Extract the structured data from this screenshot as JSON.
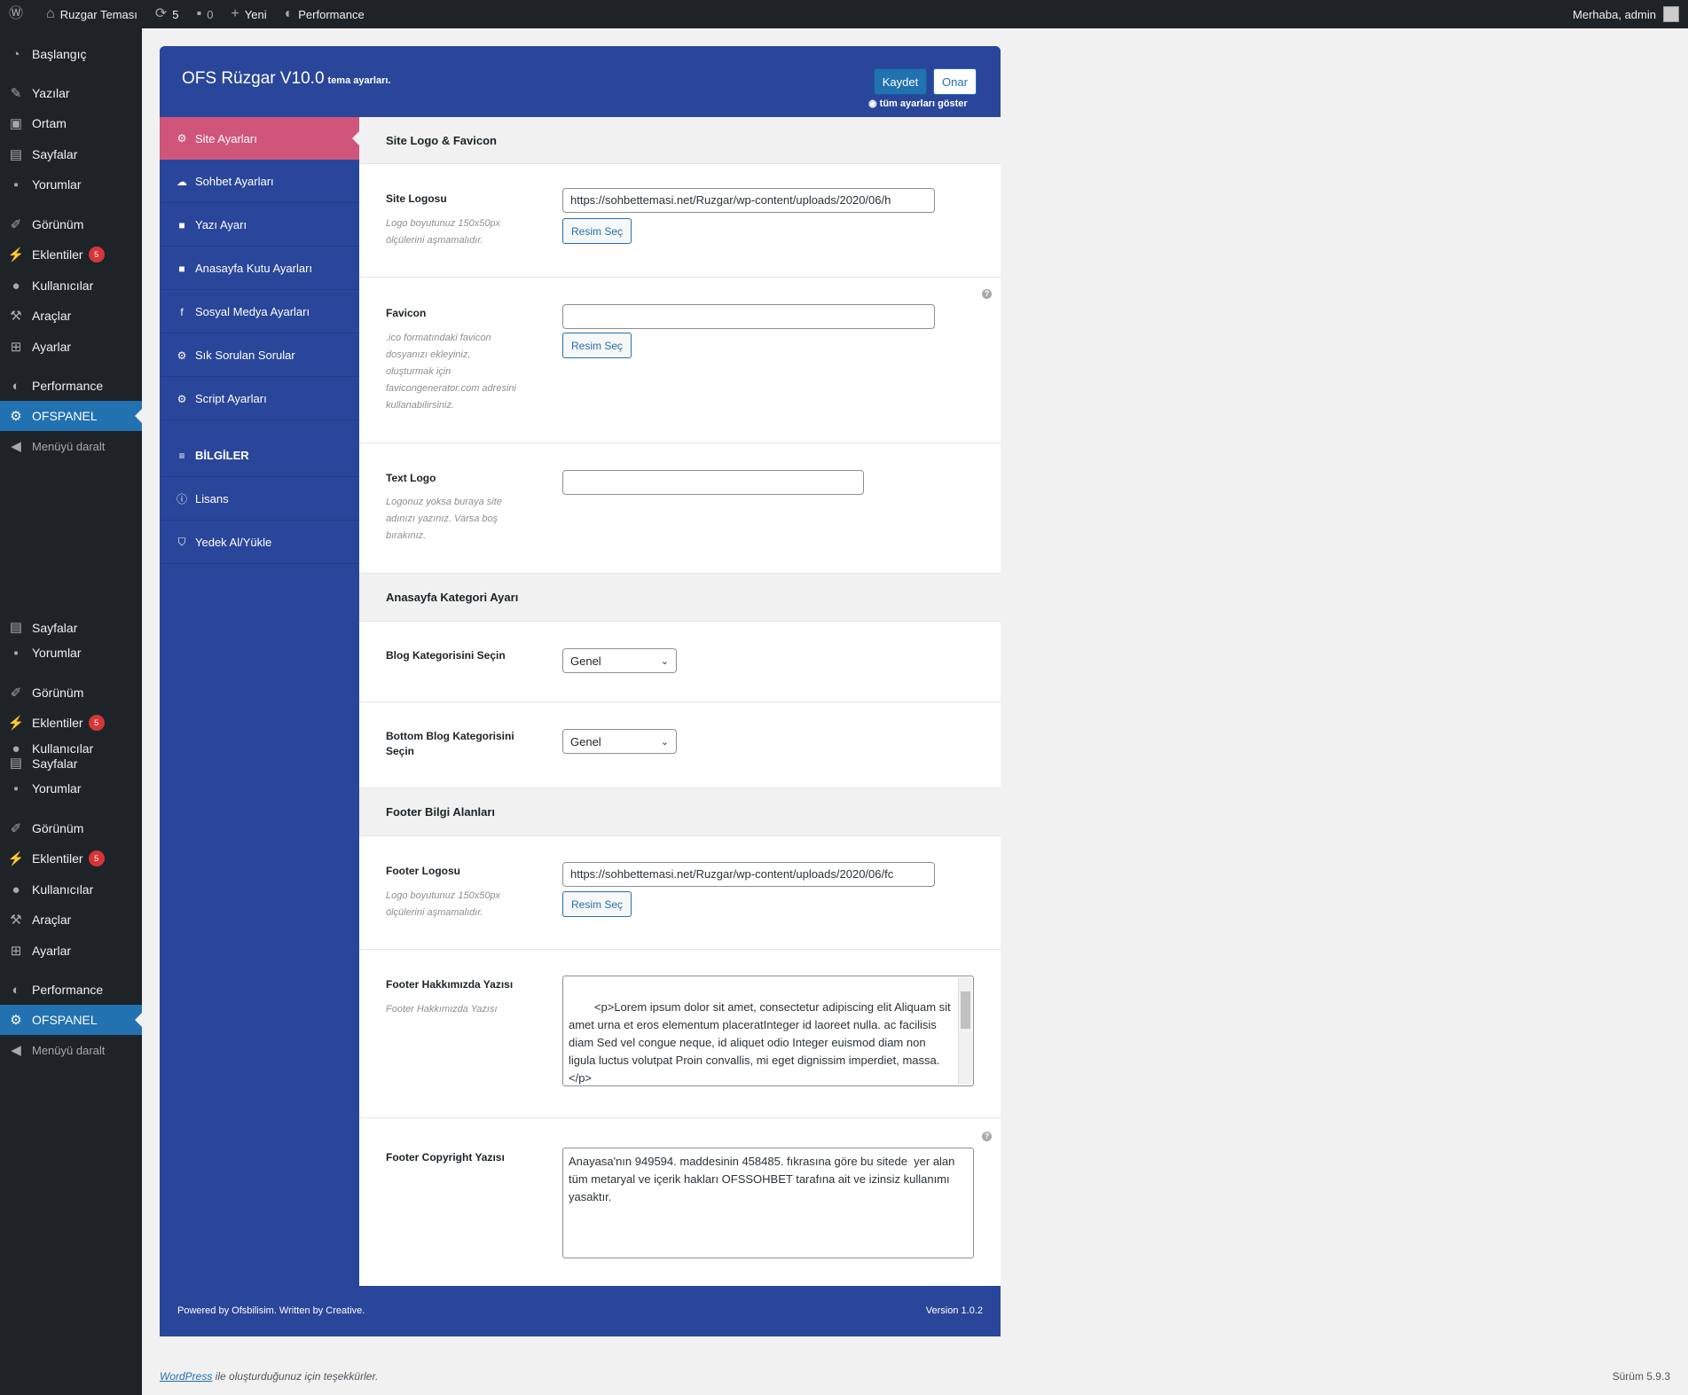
{
  "adminbar": {
    "site_name": "Ruzgar Teması",
    "updates_count": "5",
    "comments_count": "0",
    "new_label": "Yeni",
    "performance_label": "Performance",
    "greeting": "Merhaba, admin"
  },
  "adminmenu": {
    "group1": [
      "Başlangıç",
      "Yazılar",
      "Ortam",
      "Sayfalar",
      "Yorumlar",
      "Görünüm",
      "Eklentiler",
      "Kullanıcılar",
      "Araçlar",
      "Ayarlar",
      "Performance",
      "OFSPANEL",
      "Menüyü daralt"
    ],
    "group2": [
      "Sayfalar",
      "Yorumlar",
      "Görünüm",
      "Eklentiler",
      "Kullanıcılar"
    ],
    "group3": [
      "Sayfalar",
      "Yorumlar",
      "Görünüm",
      "Eklentiler",
      "Kullanıcılar",
      "Araçlar",
      "Ayarlar",
      "Performance",
      "OFSPANEL",
      "Menüyü daralt"
    ],
    "plugin_badge": "5"
  },
  "panel": {
    "title": "OFS Rüzgar V10.0",
    "subtitle": "tema ayarları.",
    "save_label": "Kaydet",
    "reset_label": "Onar",
    "show_all_label": "tüm ayarları göster",
    "nav": [
      "Site Ayarları",
      "Sohbet Ayarları",
      "Yazı Ayarı",
      "Anasayfa Kutu Ayarları",
      "Sosyal Medya Ayarları",
      "Sık Sorulan Sorular",
      "Script Ayarları"
    ],
    "nav_head": "BİLGİLER",
    "nav2": [
      "Lisans",
      "Yedek Al/Yükle"
    ],
    "footer_left": "Powered by Ofsbilisim. Written by Creative.",
    "footer_right": "Version 1.0.2"
  },
  "content": {
    "section1": "Site Logo & Favicon",
    "site_logo_label": "Site Logosu",
    "site_logo_desc": "Logo boyutunuz 150x50px ölçülerini aşmamalıdır.",
    "site_logo_value": "https://sohbettemasi.net/Ruzgar/wp-content/uploads/2020/06/h",
    "choose_label": "Resim Seç",
    "favicon_label": "Favicon",
    "favicon_desc": ".ico formatındaki favicon dosyanızı ekleyiniz, oluşturmak için favicongenerator.com adresini kullanabilirsiniz.",
    "text_logo_label": "Text Logo",
    "text_logo_desc": "Logonuz yoksa buraya site adınızı yazınız. Varsa boş bırakınız.",
    "section2": "Anasayfa Kategori Ayarı",
    "blog_cat_label": "Blog Kategorisini Seçin",
    "blog_cat_value": "Genel",
    "bottom_cat_label": "Bottom Blog Kategorisini Seçin",
    "bottom_cat_value": "Genel",
    "section3": "Footer Bilgi Alanları",
    "footer_logo_label": "Footer Logosu",
    "footer_logo_desc": "Logo boyutunuz 150x50px ölçülerini aşmamalıdır.",
    "footer_logo_value": "https://sohbettemasi.net/Ruzgar/wp-content/uploads/2020/06/fc",
    "about_label": "Footer Hakkımızda Yazısı",
    "about_desc": "Footer Hakkımızda Yazısı",
    "about_value": "<p>Lorem ipsum dolor sit amet, consectetur adipiscing elit Aliquam sit amet urna et eros elementum placeratInteger id laoreet nulla. ac facilisis diam Sed vel congue neque, id aliquet odio Integer euismod diam non ligula luctus volutpat Proin convallis, mi eget dignissim imperdiet, massa.</p>\n<p>",
    "copyright_label": "Footer Copyright Yazısı",
    "copyright_value": "Anayasa'nın 949594. maddesinin 458485. fıkrasına göre bu sitede  yer alan tüm metaryal ve içerik hakları OFSSOHBET tarafına ait ve izinsiz kullanımı yasaktır."
  },
  "wpfooter": {
    "link": "WordPress",
    "thanks": " ile oluşturduğunuz için teşekkürler.",
    "version": "Sürüm 5.9.3"
  }
}
